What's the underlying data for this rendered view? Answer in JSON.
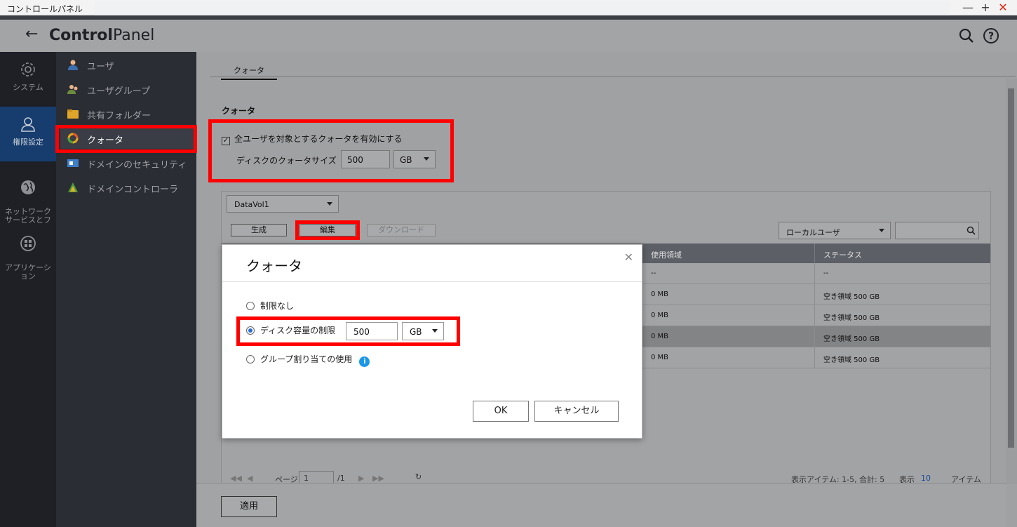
{
  "window": {
    "title": "コントロールパネル",
    "minimize": "—",
    "maximize": "+",
    "close": "✕"
  },
  "header": {
    "back": "←",
    "title_bold": "Control",
    "title_rest": "Panel"
  },
  "rail": [
    {
      "label": "システム",
      "icon": "gear-icon"
    },
    {
      "label": "権限設定",
      "icon": "user-icon"
    },
    {
      "label": "ネットワーク\nサービスとフ",
      "icon": "globe-icon"
    },
    {
      "label": "アプリケーシ\nョン",
      "icon": "apps-icon"
    }
  ],
  "subnav": [
    {
      "label": "ユーザ"
    },
    {
      "label": "ユーザグループ"
    },
    {
      "label": "共有フォルダー"
    },
    {
      "label": "クォータ"
    },
    {
      "label": "ドメインのセキュリティ"
    },
    {
      "label": "ドメインコントローラ"
    }
  ],
  "main": {
    "tab": "クォータ",
    "section_title": "クォータ",
    "enable_label": "全ユーザを対象とするクォータを有効にする",
    "disk_label": "ディスクのクォータサイズ",
    "disk_value": "500",
    "disk_unit": "GB",
    "volume": "DataVol1",
    "btn_create": "生成",
    "btn_edit": "編集",
    "btn_download": "ダウンロード",
    "user_filter": "ローカルユーザ",
    "columns": {
      "used": "使用領域",
      "status": "ステータス"
    },
    "rows": [
      {
        "used": "--",
        "status": "--"
      },
      {
        "used": "0 MB",
        "status": "空き領域 500 GB"
      },
      {
        "used": "0 MB",
        "status": "空き領域 500 GB"
      },
      {
        "used": "0 MB",
        "status": "空き領域 500 GB"
      },
      {
        "used": "0 MB",
        "status": "空き領域 500 GB"
      }
    ],
    "pager": {
      "page_label": "ページ",
      "page": "1",
      "total": "/1",
      "summary": "表示アイテム: 1-5, 合計: 5",
      "show": "表示",
      "per_page": "10",
      "items": "アイテム"
    },
    "apply": "適用"
  },
  "dialog": {
    "title": "クォータ",
    "close": "✕",
    "opt_unlimited": "制限なし",
    "opt_limit": "ディスク容量の制限",
    "limit_value": "500",
    "limit_unit": "GB",
    "opt_group": "グループ割り当ての使用",
    "ok": "OK",
    "cancel": "キャンセル"
  },
  "colors": {
    "highlight": "#ff0000",
    "rail_active": "#163d6e",
    "info": "#1a97e8"
  }
}
